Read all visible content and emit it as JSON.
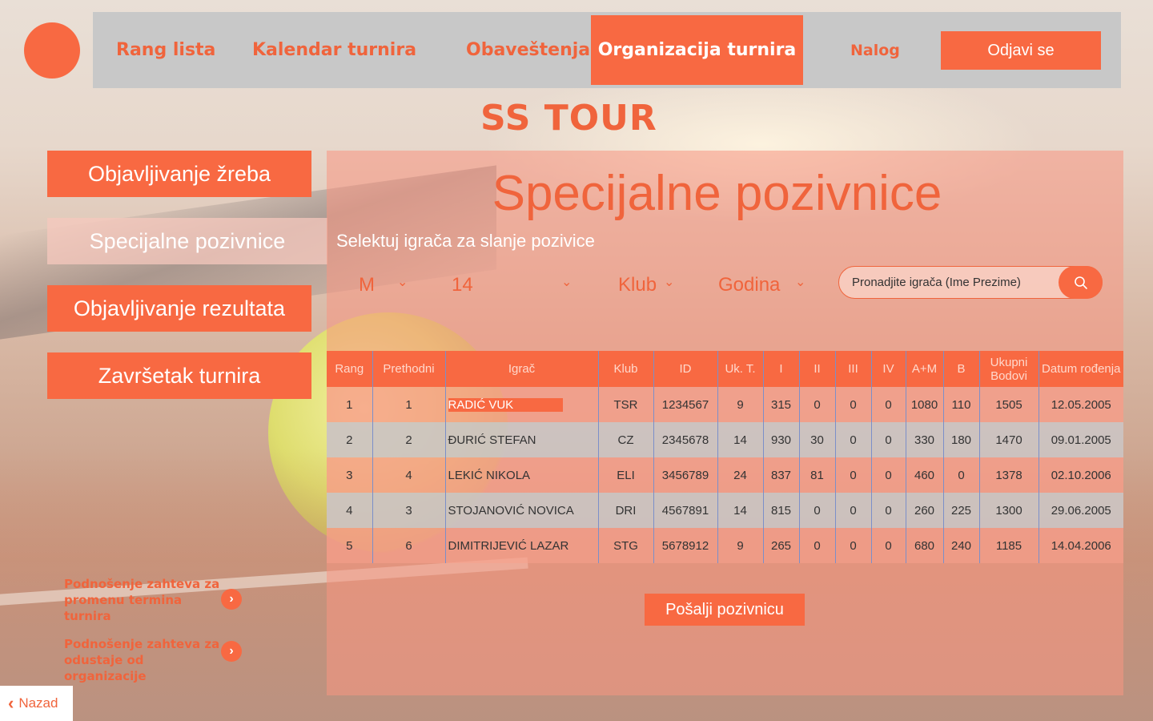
{
  "nav": {
    "items": [
      "Rang lista",
      "Kalendar turnira",
      "Obaveštenja"
    ],
    "active": "Organizacija turnira",
    "account": "Nalog",
    "logout": "Odjavi se"
  },
  "brand": "SS TOUR",
  "side_menu": [
    "Objavljivanje žreba",
    "Specijalne pozivnice",
    "Objavljivanje rezultata",
    "Završetak turnira"
  ],
  "requests": [
    "Podnošenje zahteva za promenu termina turnira",
    "Podnošenje zahteva za odustaje od organizacije"
  ],
  "back_label": "Nazad",
  "main": {
    "title": "Specijalne pozivnice",
    "subtitle": "Selektuj igrača za slanje pozivice",
    "filters": [
      "M",
      "14",
      "Klub",
      "Godina"
    ],
    "search_placeholder": "Pronadjite igrača (Ime Prezime)",
    "table": {
      "headers": [
        "Rang",
        "Prethodni",
        "Igrač",
        "Klub",
        "ID",
        "Uk. T.",
        "I",
        "II",
        "III",
        "IV",
        "A+M",
        "B",
        "Ukupni Bodovi",
        "Datum rođenja"
      ],
      "rows": [
        [
          "1",
          "1",
          "RADIĆ VUK",
          "TSR",
          "1234567",
          "9",
          "315",
          "0",
          "0",
          "0",
          "1080",
          "110",
          "1505",
          "12.05.2005"
        ],
        [
          "2",
          "2",
          "ĐURIĆ STEFAN",
          "CZ",
          "2345678",
          "14",
          "930",
          "30",
          "0",
          "0",
          "330",
          "180",
          "1470",
          "09.01.2005"
        ],
        [
          "3",
          "4",
          "LEKIĆ NIKOLA",
          "ELI",
          "3456789",
          "24",
          "837",
          "81",
          "0",
          "0",
          "460",
          "0",
          "1378",
          "02.10.2006"
        ],
        [
          "4",
          "3",
          "STOJANOVIĆ NOVICA",
          "DRI",
          "4567891",
          "14",
          "815",
          "0",
          "0",
          "0",
          "260",
          "225",
          "1300",
          "29.06.2005"
        ],
        [
          "5",
          "6",
          "DIMITRIJEVIĆ LAZAR",
          "STG",
          "5678912",
          "9",
          "265",
          "0",
          "0",
          "0",
          "680",
          "240",
          "1185",
          "14.04.2006"
        ]
      ]
    },
    "send_button": "Pošalji pozivnicu"
  },
  "colors": {
    "accent": "#f86942",
    "nav_bg": "#c8c8c8",
    "text_accent": "#f0643c"
  }
}
